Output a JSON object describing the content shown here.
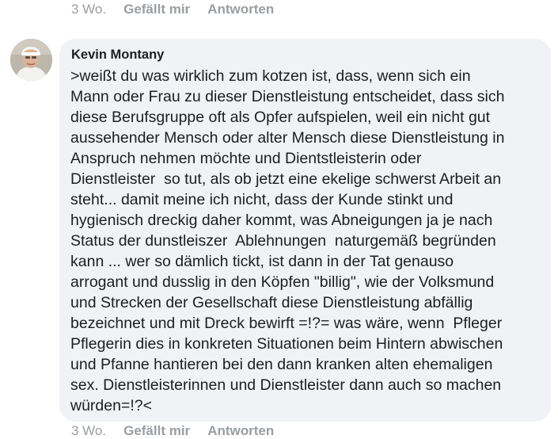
{
  "previous_comment_actions": {
    "time": "3 Wo.",
    "like_label": "Gefällt mir",
    "reply_label": "Antworten"
  },
  "comment": {
    "author": "Kevin Montany",
    "text_lines": [
      ">weißt du was wirklich zum kotzen ist, dass, wenn sich ein",
      "Mann oder Frau zu dieser Dienstleistung entscheidet, dass sich",
      "diese Berufsgruppe oft als Opfer aufspielen, weil ein nicht gut",
      "aussehender Mensch oder alter Mensch diese Dienstleistung in",
      "Anspruch nehmen möchte und Dientstleisterin oder",
      "Dienstleister  so tut, als ob jetzt eine ekelige schwerst Arbeit an",
      "steht... damit meine ich nicht, dass der Kunde stinkt und",
      "hygienisch dreckig daher kommt, was Abneigungen ja je nach",
      "Status der dunstleiszer  Ablehnungen  naturgemäß begründen",
      "kann ... wer so dämlich tickt, ist dann in der Tat genauso",
      "arrogant und dusslig in den Köpfen \"billig\", wie der Volksmund",
      "und Strecken der Gesellschaft diese Dienstleistung abfällig",
      "bezeichnet und mit Dreck bewirft =!?= was wäre, wenn  Pfleger",
      "Pflegerin dies in konkreten Situationen beim Hintern abwischen",
      "und Pfanne hantieren bei den dann kranken alten ehemaligen",
      "sex. Dienstleisterinnen und Dienstleister dann auch so machen",
      "würden=!?<"
    ]
  },
  "comment_actions": {
    "time": "3 Wo.",
    "like_label": "Gefällt mir",
    "reply_label": "Antworten"
  },
  "colors": {
    "bubble_background": "#f0f2f5",
    "text": "#1c1e21",
    "action_text": "#9a9da3"
  },
  "icons": {
    "avatar": "profile-photo"
  }
}
